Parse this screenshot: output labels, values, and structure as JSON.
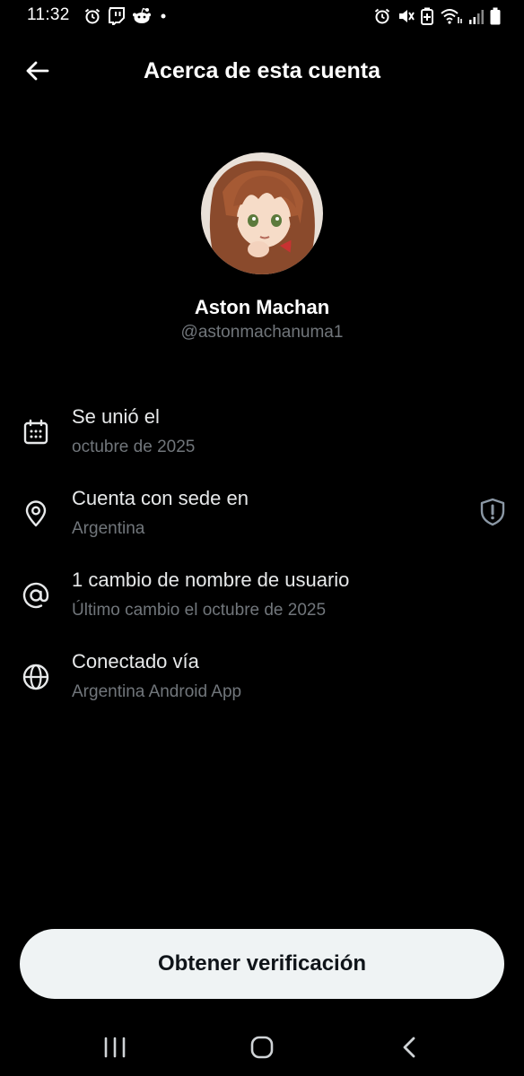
{
  "status_bar": {
    "time": "11:32",
    "left_icons": [
      "alarm-icon",
      "twitch-icon",
      "reddit-icon",
      "dot-icon"
    ],
    "right_icons": [
      "alarm-icon",
      "mute-icon",
      "battery-saver-icon",
      "wifi-icon",
      "signal-icon",
      "battery-icon"
    ]
  },
  "header": {
    "title": "Acerca de esta cuenta",
    "back_icon": "arrow-left-icon"
  },
  "profile": {
    "display_name": "Aston Machan",
    "handle": "@astonmachanuma1"
  },
  "info": [
    {
      "icon": "calendar-icon",
      "title": "Se unió el",
      "subtitle": "octubre de 2025"
    },
    {
      "icon": "location-pin-icon",
      "title": "Cuenta con sede en",
      "subtitle": "Argentina",
      "trailing_icon": "shield-icon"
    },
    {
      "icon": "at-sign-icon",
      "title": "1 cambio de nombre de usuario",
      "subtitle": "Último cambio el octubre de 2025"
    },
    {
      "icon": "globe-icon",
      "title": "Conectado vía",
      "subtitle": "Argentina Android App"
    }
  ],
  "verify_button": {
    "label": "Obtener verificación"
  },
  "nav_bar": {
    "icons": [
      "recents-icon",
      "home-icon",
      "back-icon"
    ]
  },
  "colors": {
    "background": "#000000",
    "primary_text": "#e7e9ea",
    "secondary_text": "#71767b",
    "button_bg": "#eff3f4",
    "button_text": "#0f1419"
  }
}
